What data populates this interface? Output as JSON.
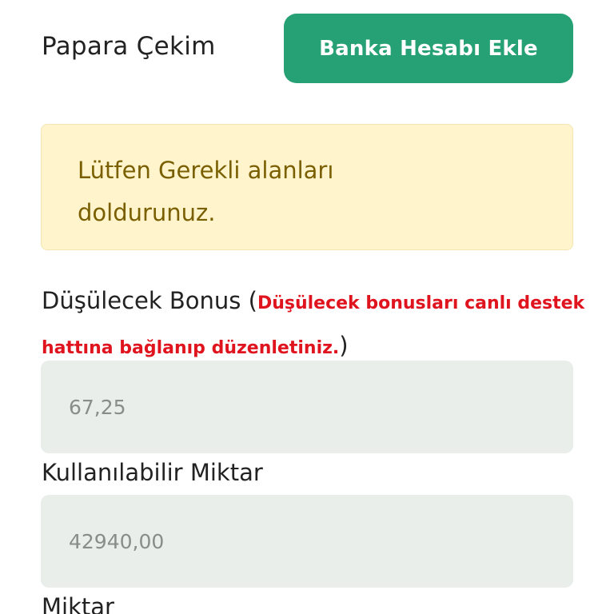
{
  "header": {
    "title": "Papara Çekim",
    "add_bank_button": "Banka Hesabı Ekle"
  },
  "alert": {
    "message": "Lütfen Gerekli alanları doldurunuz."
  },
  "form": {
    "bonus": {
      "label": "Düşülecek Bonus",
      "open_paren": " (",
      "note": "Düşülecek bonusları canlı destek hattına bağlanıp düzenletiniz.",
      "close_paren": ")",
      "value": "67,25"
    },
    "available": {
      "label": "Kullanılabilir Miktar",
      "value": "42940,00"
    },
    "amount": {
      "label": "Miktar"
    }
  },
  "colors": {
    "primary_button": "#26a176",
    "alert_background": "#fff4cc",
    "alert_text": "#7a5f00",
    "warning_text": "#e0141e",
    "field_background": "#eaeeeb"
  }
}
